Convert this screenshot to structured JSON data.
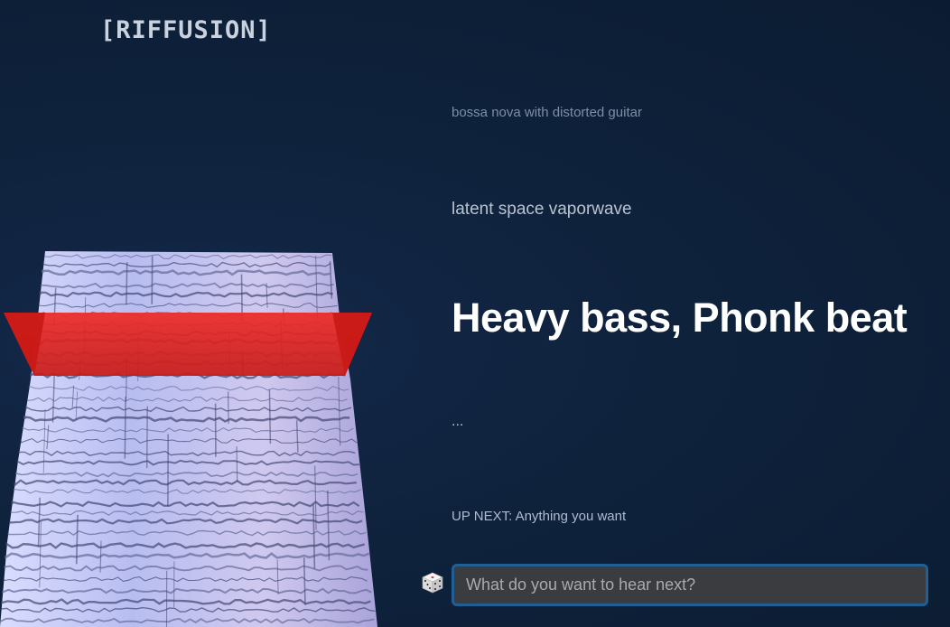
{
  "app": {
    "logo": "[RIFFUSION]"
  },
  "prompts": {
    "past_2": "bossa nova with distorted guitar",
    "past_1": "latent space vaporwave",
    "current": "Heavy bass, Phonk beat",
    "next": "..."
  },
  "up_next": {
    "label": "UP NEXT: Anything you want"
  },
  "prompt_input": {
    "placeholder": "What do you want to hear next?",
    "value": ""
  },
  "icons": {
    "randomize": "dice-icon"
  },
  "colors": {
    "background": "#0d1f36",
    "playhead": "#e0201e",
    "spectrogram": "#c7c9f0",
    "input_border": "#1f5f94",
    "input_background": "#3a3c40"
  }
}
